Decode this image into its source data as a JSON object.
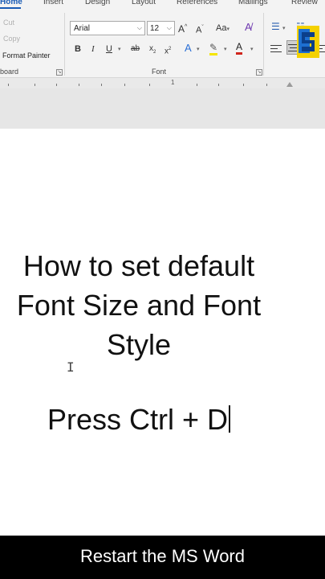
{
  "ribbon": {
    "tabs": [
      "Home",
      "Insert",
      "Design",
      "Layout",
      "References",
      "Mailings",
      "Review"
    ],
    "clipboard": {
      "cut": "Cut",
      "copy": "Copy",
      "format_painter": "Format Painter",
      "group_label": "board"
    },
    "font": {
      "font_name": "Arial",
      "font_size": "12",
      "grow": "A",
      "shrink": "A",
      "change_case": "Aa",
      "bold": "B",
      "italic": "I",
      "underline": "U",
      "strike": "ab",
      "subscript": "x",
      "superscript": "x",
      "text_effects": "A",
      "highlight_color": "#f5e500",
      "font_color": "A",
      "font_color_value": "#d0251c",
      "group_label": "Font"
    }
  },
  "ruler": {
    "label": "1"
  },
  "document": {
    "title_lines": [
      "How to set default",
      "Font Size and Font",
      "Style"
    ],
    "instruction": "Press Ctrl + D"
  },
  "caption": "Restart the MS Word"
}
